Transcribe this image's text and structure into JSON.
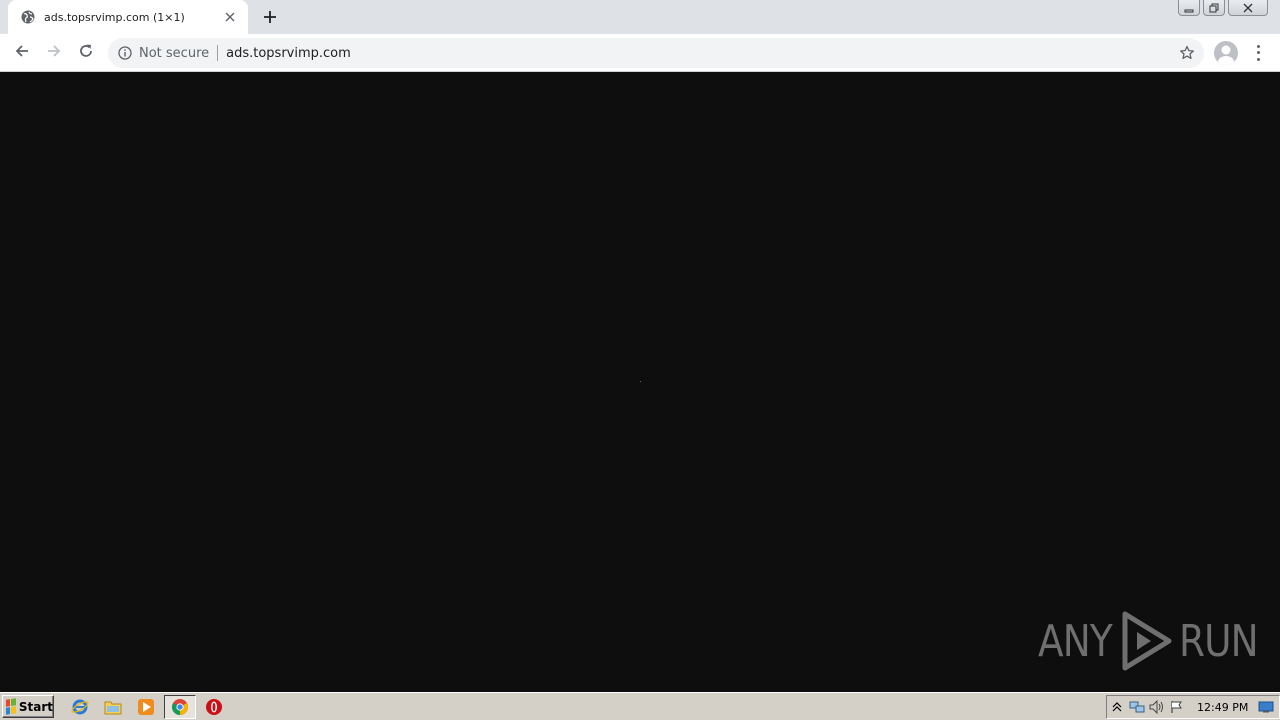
{
  "browser": {
    "tab": {
      "title": "ads.topsrvimp.com (1×1)"
    },
    "omnibox": {
      "security_label": "Not secure",
      "url": "ads.topsrvimp.com"
    }
  },
  "page": {
    "background": "#0e0e0f"
  },
  "watermark": {
    "left_text": "ANY",
    "right_text": "RUN"
  },
  "taskbar": {
    "start_label": "Start",
    "clock": "12:49 PM",
    "pinned": [
      "internet-explorer-icon",
      "file-explorer-icon",
      "media-player-icon",
      "chrome-icon",
      "opera-icon"
    ],
    "tray": [
      "show-hidden-icon",
      "network-icon",
      "volume-icon",
      "action-center-flag-icon",
      "show-desktop-icon"
    ]
  }
}
